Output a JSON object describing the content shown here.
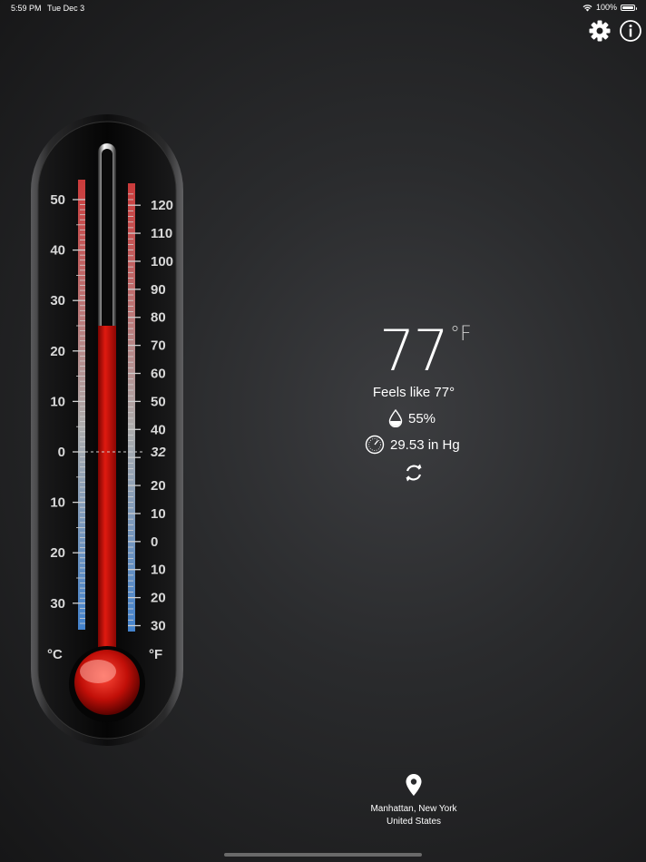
{
  "status_bar": {
    "time": "5:59 PM",
    "date": "Tue Dec 3",
    "battery": "100%"
  },
  "icons": {
    "settings": "gear-icon",
    "info": "info-icon",
    "humidity": "water-drop-icon",
    "pressure": "barometer-icon",
    "refresh": "refresh-icon",
    "location": "location-pin-icon"
  },
  "thermometer": {
    "celsius_label": "°C",
    "fahrenheit_label": "°F",
    "celsius_ticks": [
      "50",
      "40",
      "30",
      "20",
      "10",
      "0",
      "10",
      "20",
      "30"
    ],
    "fahrenheit_ticks": [
      "120",
      "110",
      "100",
      "90",
      "80",
      "70",
      "60",
      "50",
      "40",
      "32",
      "20",
      "10",
      "0",
      "10",
      "20",
      "30"
    ],
    "mercury_level_fahrenheit": 77,
    "colors": {
      "mercury": "#d1120a",
      "warm_scale": "#e04040",
      "cold_scale": "#4a8fe0"
    }
  },
  "weather": {
    "temperature": "77",
    "unit": "°F",
    "feels_like": "Feels like 77°",
    "humidity": "55%",
    "pressure": "29.53 in Hg"
  },
  "location": {
    "line1": "Manhattan, New York",
    "line2": "United States"
  }
}
